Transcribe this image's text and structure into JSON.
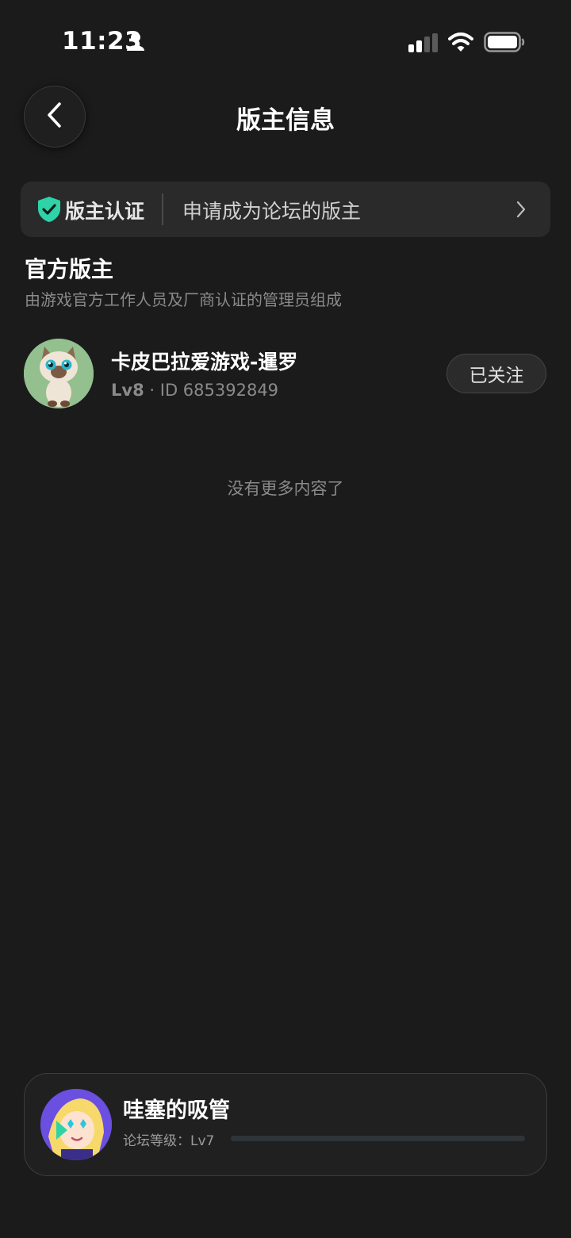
{
  "status_bar": {
    "time": "11:23"
  },
  "header": {
    "title": "版主信息"
  },
  "cert_banner": {
    "label": "版主认证",
    "description": "申请成为论坛的版主",
    "accent_color": "#2ed3a8"
  },
  "section": {
    "title": "官方版主",
    "subtitle": "由游戏官方工作人员及厂商认证的管理员组成"
  },
  "moderators": [
    {
      "name": "卡皮巴拉爱游戏-暹罗",
      "level": "Lv8",
      "separator": "·",
      "id_text": "ID 685392849",
      "follow_label": "已关注"
    }
  ],
  "end_text": "没有更多内容了",
  "user_card": {
    "name": "哇塞的吸管",
    "level_prefix": "论坛等级：",
    "level": "Lv7",
    "level_progress": 0.0
  }
}
